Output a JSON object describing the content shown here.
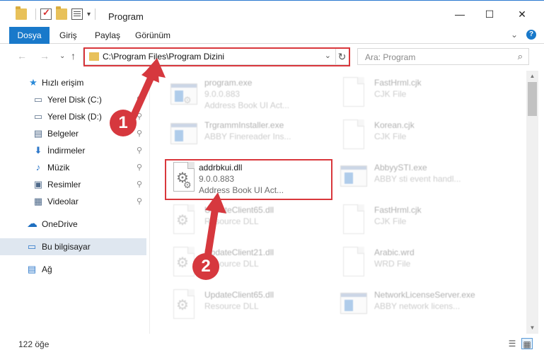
{
  "window": {
    "title": "Program",
    "minimize": "—",
    "maximize": "☐",
    "close": "✕"
  },
  "ribbon": {
    "tabs": [
      "Dosya",
      "Giriş",
      "Paylaş",
      "Görünüm"
    ],
    "expand_glyph": "⌄",
    "help_glyph": "?"
  },
  "nav_arrows": {
    "back": "←",
    "forward": "→",
    "recent": "⌄",
    "up": "↑"
  },
  "address": {
    "path": "C:\\Program Files\\Program Dizini",
    "dropdown": "⌄",
    "refresh": "↻"
  },
  "search": {
    "placeholder": "Ara: Program",
    "icon": "⌕"
  },
  "sidebar": {
    "items": [
      {
        "label": "Hızlı erişim",
        "icon": "star-icon",
        "glyph": "★",
        "color": "#2a8ad8"
      },
      {
        "label": "Yerel Disk (C:)",
        "icon": "drive-icon",
        "glyph": "▭",
        "color": "#5b6f89",
        "pin": "📌"
      },
      {
        "label": "Yerel Disk (D:)",
        "icon": "drive-icon",
        "glyph": "▭",
        "color": "#5b6f89",
        "pin": "📌"
      },
      {
        "label": "Belgeler",
        "icon": "documents-icon",
        "glyph": "▤",
        "color": "#4f6a8a",
        "pin": "📌"
      },
      {
        "label": "İndirmeler",
        "icon": "download-icon",
        "glyph": "⬇",
        "color": "#2c77c9",
        "pin": "📌"
      },
      {
        "label": "Müzik",
        "icon": "music-icon",
        "glyph": "♪",
        "color": "#2c77c9",
        "pin": "📌"
      },
      {
        "label": "Resimler",
        "icon": "pictures-icon",
        "glyph": "▣",
        "color": "#4f6a8a",
        "pin": "📌"
      },
      {
        "label": "Videolar",
        "icon": "videos-icon",
        "glyph": "▦",
        "color": "#4f6a8a",
        "pin": "📌"
      },
      {
        "label": "OneDrive",
        "icon": "cloud-icon",
        "glyph": "☁",
        "color": "#1f6fc0"
      },
      {
        "label": "Bu bilgisayar",
        "icon": "computer-icon",
        "glyph": "▭",
        "color": "#2c77c9"
      },
      {
        "label": "Ağ",
        "icon": "network-icon",
        "glyph": "▤",
        "color": "#2c77c9"
      }
    ]
  },
  "files": [
    {
      "name": "program.exe",
      "line2": "9.0.0.883",
      "line3": "Address Book UI Act...",
      "type": "exe-icon",
      "dim": true
    },
    {
      "name": "FastHrml.cjk",
      "line2": "CJK File",
      "line3": "",
      "type": "doc-icon",
      "dim": true
    },
    {
      "name": "TrgrammInstaller.exe",
      "line2": "ABBY Finereader Ins...",
      "line3": "",
      "type": "window-icon",
      "dim": true
    },
    {
      "name": "Korean.cjk",
      "line2": "CJK File",
      "line3": "",
      "type": "doc-icon",
      "dim": true
    },
    {
      "name": "addrbkui.dll",
      "line2": "9.0.0.883",
      "line3": "Address Book UI Act...",
      "type": "dll-icon",
      "dim": false
    },
    {
      "name": "AbbyySTI.exe",
      "line2": "ABBY sti event handl...",
      "line3": "",
      "type": "window-icon",
      "dim": true
    },
    {
      "name": "UpdateClient65.dll",
      "line2": "Resource DLL",
      "line3": "",
      "type": "dll-icon",
      "dim": true
    },
    {
      "name": "FastHrml.cjk",
      "line2": "CJK File",
      "line3": "",
      "type": "doc-icon",
      "dim": true
    },
    {
      "name": "UpdateClient21.dll",
      "line2": "Resource DLL",
      "line3": "",
      "type": "dll-icon",
      "dim": true
    },
    {
      "name": "Arabic.wrd",
      "line2": "WRD File",
      "line3": "",
      "type": "doc-icon",
      "dim": true
    },
    {
      "name": "UpdateClient65.dll",
      "line2": "Resource DLL",
      "line3": "",
      "type": "dll-icon",
      "dim": true
    },
    {
      "name": "NetworkLicenseServer.exe",
      "line2": "ABBY network licens...",
      "line3": "",
      "type": "window-icon",
      "dim": true
    }
  ],
  "status": {
    "count": "122 öğe"
  },
  "annotations": {
    "step1": "1",
    "step2": "2",
    "color": "#d6383e"
  }
}
